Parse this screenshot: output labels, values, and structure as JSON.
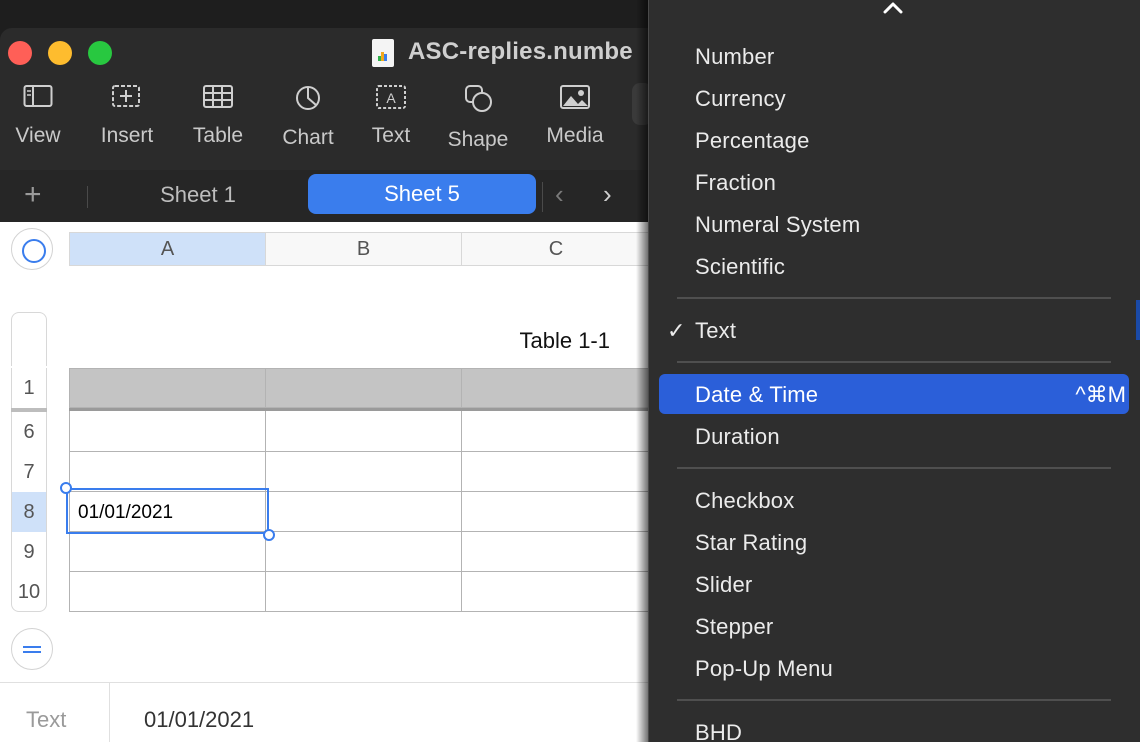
{
  "window": {
    "title": "ASC-replies.numbe",
    "traffic_lights": [
      "close",
      "minimize",
      "maximize"
    ]
  },
  "toolbar": {
    "items": [
      {
        "label": "View",
        "icon": "sidebar-view-icon"
      },
      {
        "label": "Insert",
        "icon": "insert-plus-icon"
      },
      {
        "label": "Table",
        "icon": "table-grid-icon"
      },
      {
        "label": "Chart",
        "icon": "pie-chart-icon"
      },
      {
        "label": "Text",
        "icon": "text-box-icon"
      },
      {
        "label": "Shape",
        "icon": "shape-icon"
      },
      {
        "label": "Media",
        "icon": "photo-icon"
      }
    ]
  },
  "sheets": {
    "add_symbol": "+",
    "tabs": [
      {
        "label": "Sheet 1",
        "active": false
      },
      {
        "label": "Sheet 5",
        "active": true
      }
    ],
    "prev_symbol": "‹",
    "next_symbol": "›"
  },
  "table": {
    "title": "Table 1-1",
    "columns": [
      "A",
      "B",
      "C"
    ],
    "rows": [
      "1",
      "6",
      "7",
      "8",
      "9",
      "10"
    ],
    "selected_cell_value": "01/01/2021"
  },
  "footer": {
    "format_label": "Text",
    "cell_value": "01/01/2021"
  },
  "format_menu": {
    "groups": [
      [
        "Number",
        "Currency",
        "Percentage",
        "Fraction",
        "Numeral System",
        "Scientific"
      ],
      [
        "Text"
      ],
      [
        "Date & Time",
        "Duration"
      ],
      [
        "Checkbox",
        "Star Rating",
        "Slider",
        "Stepper",
        "Pop-Up Menu"
      ],
      [
        "BHD"
      ]
    ],
    "checked_item": "Text",
    "highlighted_item": "Date & Time",
    "highlighted_shortcut": "^⌘M",
    "checkmark": "✓"
  },
  "colors": {
    "accent": "#3a7ded",
    "menu_highlight": "#2b5fd9",
    "menu_bg": "#2e2e2e",
    "window_bg": "#2b2b2b"
  }
}
